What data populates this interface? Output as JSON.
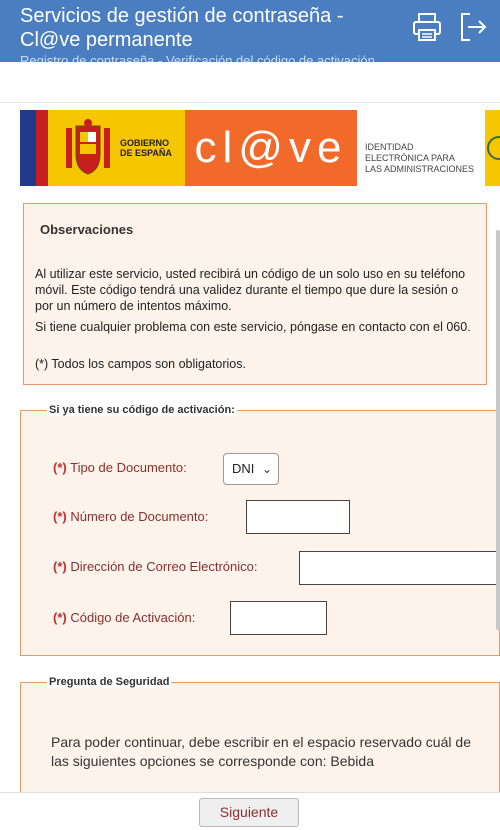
{
  "header": {
    "title": "Servicios de gestión de contraseña - Cl@ve permanente",
    "subtitle": "Registro de contraseña - Verificación del código de activación"
  },
  "icons": {
    "print": "printer-icon",
    "exit": "logout-icon"
  },
  "banner": {
    "gobierno_line1": "GOBIERNO",
    "gobierno_line2": "DE ESPAÑA",
    "clave_logo": "cl@ve",
    "identidad_line1": "IDENTIDAD",
    "identidad_line2": "ELECTRÓNICA PARA",
    "identidad_line3": "LAS ADMINISTRACIONES"
  },
  "observaciones": {
    "title": "Observaciones",
    "p1": "Al utilizar este servicio, usted recibirá un código de un solo uso en su teléfono móvil. Este código tendrá una validez durante el tiempo que dure la sesión o por un número de intentos máximo.",
    "p2": "Si tiene cualquier problema con este servicio, póngase en contacto con el 060.",
    "p3": "(*) Todos los campos son obligatorios."
  },
  "form": {
    "legend": "Si ya tiene su código de activación:",
    "required_mark": "(*)",
    "tipo_label": "Tipo de Documento:",
    "tipo_value": "DNI",
    "numero_label": "Número de Documento:",
    "numero_value": "",
    "correo_label": "Dirección de Correo Electrónico:",
    "correo_value": "",
    "codigo_label": "Código de Activación:",
    "codigo_value": ""
  },
  "security": {
    "legend": "Pregunta de Seguridad",
    "text": "Para poder continuar, debe escribir en el espacio reservado cuál de las siguientes opciones se corresponde con: Bebida"
  },
  "footer": {
    "next_label": "Siguiente"
  },
  "colors": {
    "header_bg": "#4a7ec0",
    "panel_bg": "#fdf3ea",
    "panel_border": "#e49a68",
    "label_color": "#8a2f2f",
    "clave_orange": "#f26a2a",
    "gob_yellow": "#f6c600"
  }
}
